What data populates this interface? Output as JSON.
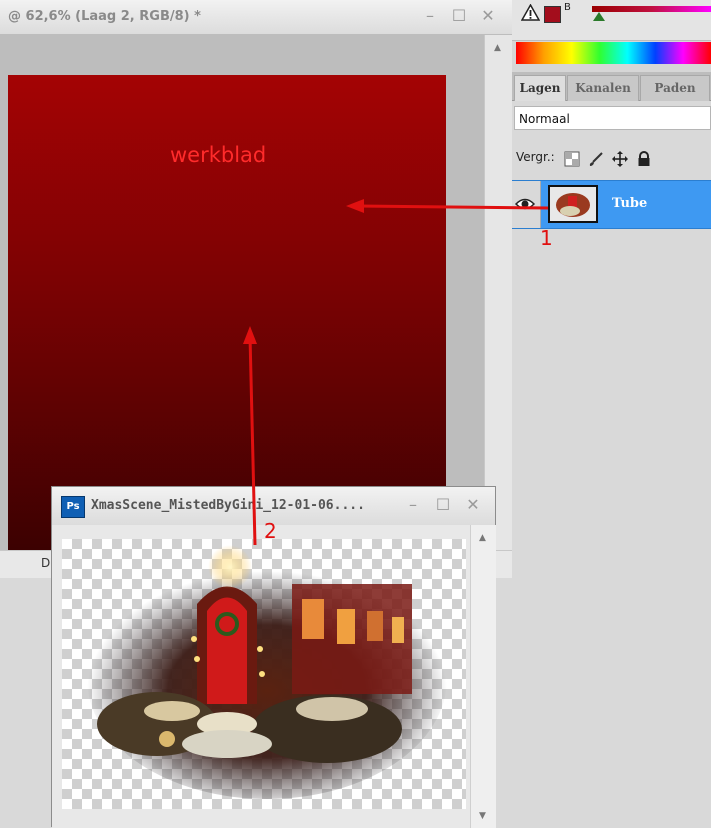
{
  "main_window": {
    "title": "@ 62,6% (Laag 2, RGB/8) *",
    "canvas_label": "werkblad",
    "controls": {
      "minimize": "–",
      "maximize": "☐",
      "close": "✕"
    },
    "hscroll_fragment": "D"
  },
  "right_panel": {
    "channel_label": "B",
    "colors": {
      "foreground": "#a30d1c",
      "layer_selected": "#3e99f2"
    },
    "tabs": [
      "Lagen",
      "Kanalen",
      "Paden"
    ],
    "active_tab": "Lagen",
    "blend_mode": "Normaal",
    "lock_label": "Vergr.:",
    "layers": [
      {
        "name": "Tube",
        "visible": true,
        "selected": true
      }
    ]
  },
  "sub_window": {
    "title": "XmasScene_MistedByGini_12-01-06....",
    "app_icon": "Ps",
    "controls": {
      "minimize": "–",
      "maximize": "☐",
      "close": "✕"
    }
  },
  "annotations": {
    "arrow_1_label": "1",
    "arrow_2_label": "2",
    "color": "#e01010"
  }
}
